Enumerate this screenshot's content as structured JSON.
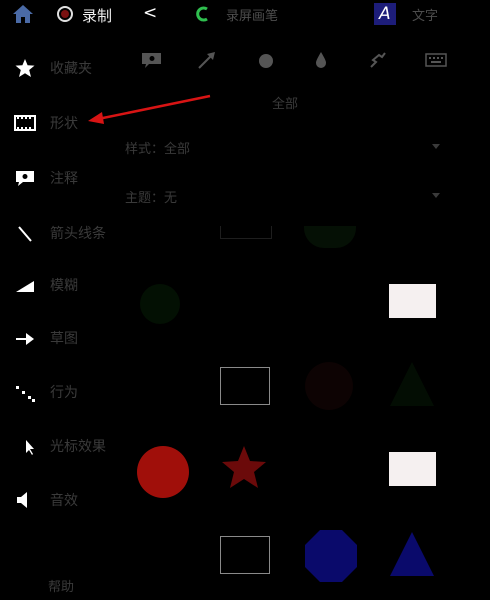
{
  "topbar": {
    "record_label": "录制",
    "back_glyph": "<",
    "screen_label": "录屏画笔",
    "text_label": "文字",
    "text_badge": "A"
  },
  "sidebar": {
    "items": [
      {
        "label": "收藏夹",
        "icon": "star-icon"
      },
      {
        "label": "形状",
        "icon": "film-strip-icon"
      },
      {
        "label": "注释",
        "icon": "speech-bubble-icon"
      },
      {
        "label": "箭头线条",
        "icon": "line-icon"
      },
      {
        "label": "模糊",
        "icon": "ramp-icon"
      },
      {
        "label": "草图",
        "icon": "arrow-right-icon"
      },
      {
        "label": "行为",
        "icon": "dots-icon"
      },
      {
        "label": "光标效果",
        "icon": "cursor-icon"
      },
      {
        "label": "音效",
        "icon": "speaker-icon"
      }
    ],
    "bottom_label": "帮助"
  },
  "toolbar": {
    "icons": [
      "callout-icon",
      "arrow-icon",
      "circle-icon",
      "blur-drop-icon",
      "scribble-icon",
      "keyboard-icon"
    ]
  },
  "panel": {
    "title": "全部",
    "filter_style": {
      "label": "样式：全部"
    },
    "filter_theme": {
      "label": "主题：无"
    }
  },
  "colors": {
    "red": "#a00f0a",
    "dark_red": "#6b0a0a",
    "navy": "#0a0a6b",
    "white_rect": "#f5f0f0",
    "star": "#ffffff"
  }
}
